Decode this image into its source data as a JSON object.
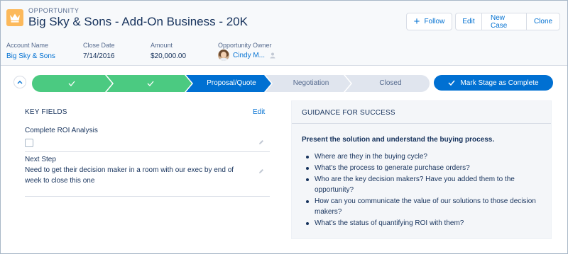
{
  "header": {
    "object_type": "OPPORTUNITY",
    "title": "Big Sky & Sons - Add-On Business - 20K",
    "icon": "crown-icon",
    "icon_color": "#fcb95b"
  },
  "actions": {
    "follow": "Follow",
    "edit": "Edit",
    "new_case": "New Case",
    "clone": "Clone"
  },
  "highlights": {
    "account_label": "Account Name",
    "account_value": "Big Sky & Sons",
    "close_date_label": "Close Date",
    "close_date_value": "7/14/2016",
    "amount_label": "Amount",
    "amount_value": "$20,000.00",
    "owner_label": "Opportunity Owner",
    "owner_value": "Cindy M..."
  },
  "path": {
    "stages": [
      {
        "label": "",
        "status": "complete"
      },
      {
        "label": "",
        "status": "complete"
      },
      {
        "label": "Proposal/Quote",
        "status": "current"
      },
      {
        "label": "Negotiation",
        "status": "incomplete"
      },
      {
        "label": "Closed",
        "status": "incomplete"
      }
    ],
    "mark_button": "Mark Stage as Complete",
    "colors": {
      "complete": "#4bca81",
      "current": "#0070d2",
      "incomplete": "#e0e5ee"
    }
  },
  "key_fields": {
    "heading": "KEY FIELDS",
    "edit": "Edit",
    "roi_label": "Complete ROI Analysis",
    "roi_checked": false,
    "next_step_label": "Next Step",
    "next_step_value": "Need to get their decision maker in a room with our exec by end of week to close this one"
  },
  "guidance": {
    "heading": "GUIDANCE FOR SUCCESS",
    "intro": "Present the solution and understand the buying process.",
    "items": [
      "Where are they in the buying cycle?",
      "What's the process to generate purchase orders?",
      "Who are the key decision makers? Have you added them to the opportunity?",
      "How can you communicate the value of our solutions to those decision makers?",
      "What's the status of quantifying ROI with them?"
    ]
  }
}
